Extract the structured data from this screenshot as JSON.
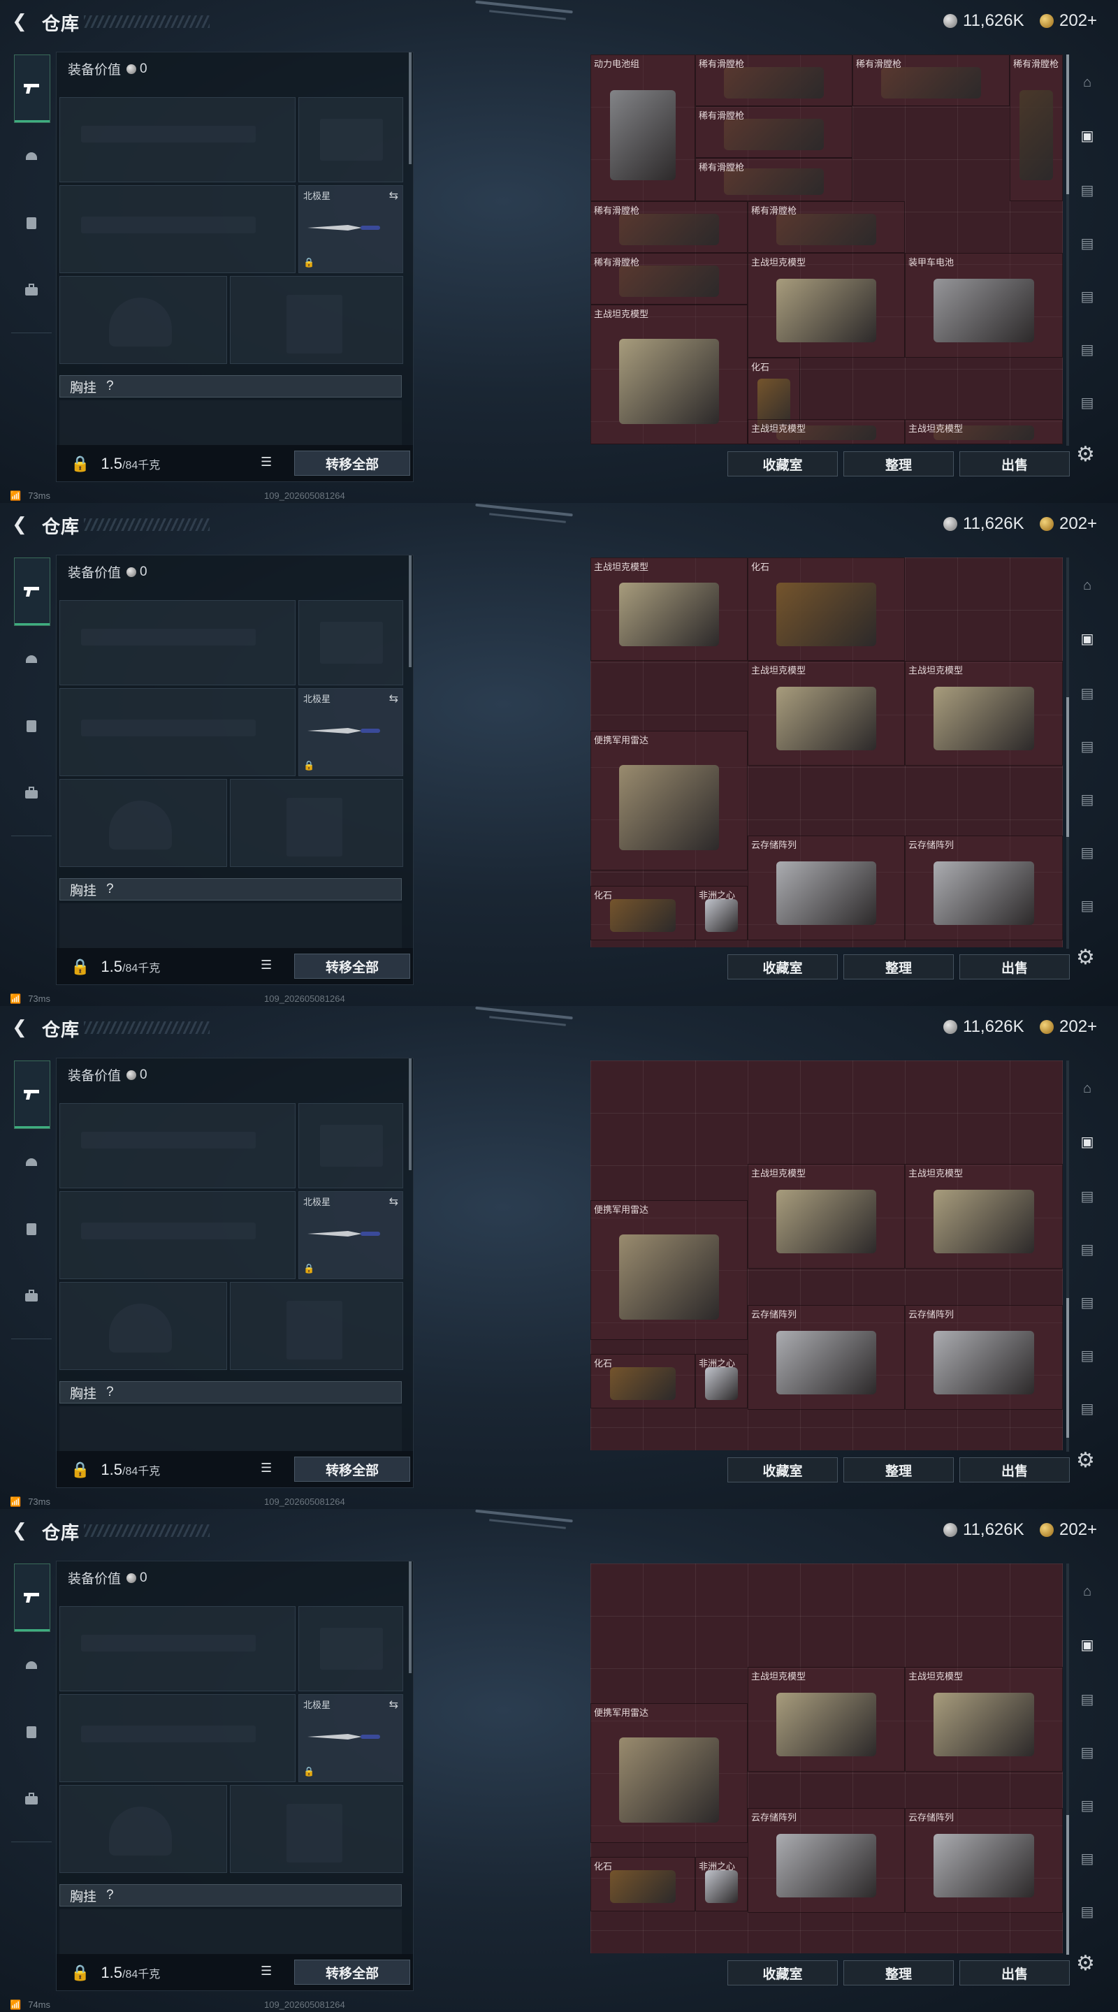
{
  "title": "仓库",
  "currency": {
    "silver": "11,626K",
    "gold": "202+"
  },
  "equipment": {
    "value_label": "装备价值",
    "value": "0",
    "knife_slot_label": "北极星",
    "chest_label": "胸挂",
    "chest_question": "?",
    "weight_value": "1.5",
    "weight_capacity": "/84千克",
    "transfer_all": "转移全部"
  },
  "storage": {
    "buttons": {
      "collection": "收藏室",
      "organize": "整理",
      "sell": "出售"
    },
    "frame1_items": [
      "动力电池组",
      "稀有滑膛枪",
      "稀有滑膛枪",
      "稀有滑膛枪",
      "稀有滑膛枪",
      "稀有滑膛枪",
      "稀有滑膛枪",
      "稀有滑膛枪",
      "稀有滑膛枪",
      "主战坦克模型",
      "装甲车电池",
      "主战坦克模型",
      "化石",
      "主战坦克模型",
      "主战坦克模型"
    ],
    "frame2_items": [
      "主战坦克模型",
      "化石",
      "主战坦克模型",
      "主战坦克模型",
      "便携军用雷达",
      "云存储阵列",
      "云存储阵列",
      "化石",
      "非洲之心"
    ],
    "frame3_items": [
      "主战坦克模型",
      "主战坦克模型",
      "便携军用雷达",
      "云存储阵列",
      "云存储阵列",
      "化石",
      "非洲之心"
    ]
  },
  "status": {
    "ping_a": "73ms",
    "ping_b": "73ms",
    "ping_c": "73ms",
    "ping_d": "74ms",
    "build": "109_202605081264"
  },
  "colors": {
    "accent": "#3fae80",
    "storage_bg": "#3c1f27"
  }
}
